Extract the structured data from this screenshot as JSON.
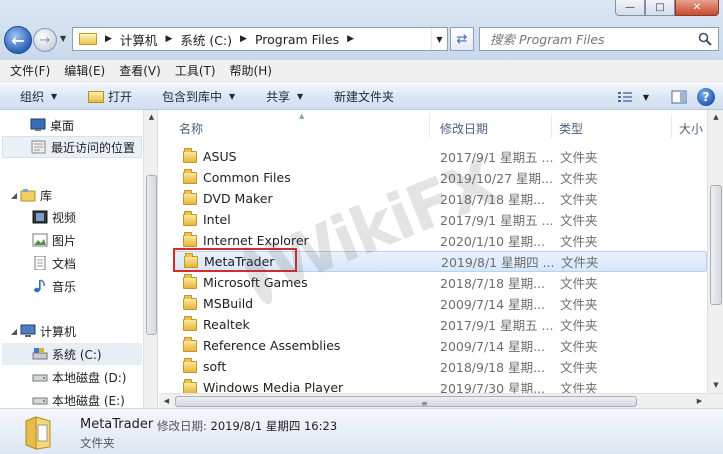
{
  "address": {
    "crumbs": [
      "计算机",
      "系统 (C:)",
      "Program Files"
    ]
  },
  "search": {
    "placeholder": "搜索 Program Files"
  },
  "menu": [
    "文件(F)",
    "编辑(E)",
    "查看(V)",
    "工具(T)",
    "帮助(H)"
  ],
  "toolbar": {
    "organize": "组织",
    "open": "打开",
    "include": "包含到库中",
    "share": "共享",
    "new_folder": "新建文件夹"
  },
  "nav": {
    "desktop": "桌面",
    "recent": "最近访问的位置",
    "libraries": "库",
    "videos": "视频",
    "pictures": "图片",
    "documents": "文档",
    "music": "音乐",
    "computer": "计算机",
    "drive_c": "系统 (C:)",
    "drive_d": "本地磁盘 (D:)",
    "drive_e": "本地磁盘 (E:)"
  },
  "columns": {
    "name": "名称",
    "date": "修改日期",
    "type": "类型",
    "size": "大小"
  },
  "files": [
    {
      "name": "ASUS",
      "date": "2017/9/1 星期五 ...",
      "type": "文件夹"
    },
    {
      "name": "Common Files",
      "date": "2019/10/27 星期...",
      "type": "文件夹"
    },
    {
      "name": "DVD Maker",
      "date": "2018/7/18 星期...",
      "type": "文件夹"
    },
    {
      "name": "Intel",
      "date": "2017/9/1 星期五 ...",
      "type": "文件夹"
    },
    {
      "name": "Internet Explorer",
      "date": "2020/1/10 星期...",
      "type": "文件夹"
    },
    {
      "name": "MetaTrader",
      "date": "2019/8/1 星期四 ...",
      "type": "文件夹"
    },
    {
      "name": "Microsoft Games",
      "date": "2018/7/18 星期...",
      "type": "文件夹"
    },
    {
      "name": "MSBuild",
      "date": "2009/7/14 星期...",
      "type": "文件夹"
    },
    {
      "name": "Realtek",
      "date": "2017/9/1 星期五 ...",
      "type": "文件夹"
    },
    {
      "name": "Reference Assemblies",
      "date": "2009/7/14 星期...",
      "type": "文件夹"
    },
    {
      "name": "soft",
      "date": "2018/9/18 星期...",
      "type": "文件夹"
    },
    {
      "name": "Windows Media Player",
      "date": "2019/7/30 星期...",
      "type": "文件夹"
    }
  ],
  "details": {
    "name": "MetaTrader",
    "date_label": "修改日期:",
    "date_value": "2019/8/1 星期四 16:23",
    "type": "文件夹"
  },
  "watermark": "WikiFX",
  "colors": {
    "selection": "#d8e7fb",
    "highlight": "#d52b2b",
    "accent": "#2a63b8"
  }
}
